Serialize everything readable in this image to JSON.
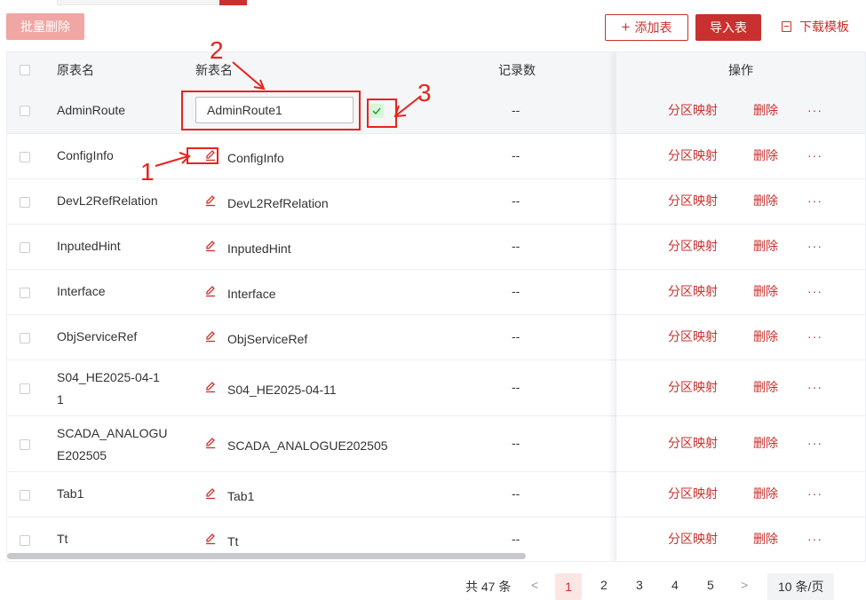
{
  "toolbar": {
    "batch_delete": "批量删除",
    "add_table": "添加表",
    "import_table": "导入表",
    "download_template": "下载模板"
  },
  "table": {
    "headers": {
      "original_name": "原表名",
      "new_name": "新表名",
      "record_count": "记录数",
      "actions": "操作"
    },
    "editing": {
      "original_name": "AdminRoute",
      "input_value": "AdminRoute1"
    },
    "rows": [
      {
        "original_name": "ConfigInfo",
        "new_name": "ConfigInfo",
        "count": "--"
      },
      {
        "original_name": "DevL2RefRelation",
        "new_name": "DevL2RefRelation",
        "count": "--"
      },
      {
        "original_name": "InputedHint",
        "new_name": "InputedHint",
        "count": "--"
      },
      {
        "original_name": "Interface",
        "new_name": "Interface",
        "count": "--"
      },
      {
        "original_name": "ObjServiceRef",
        "new_name": "ObjServiceRef",
        "count": "--"
      },
      {
        "original_name": "S04_HE2025-04-11",
        "original_name_line1": "S04_HE2025-04-1",
        "original_name_line2": "1",
        "new_name": "S04_HE2025-04-11",
        "count": "--"
      },
      {
        "original_name": "SCADA_ANALOGUE202505",
        "original_name_line1": "SCADA_ANALOGU",
        "original_name_line2": "E202505",
        "new_name": "SCADA_ANALOGUE202505",
        "count": "--"
      },
      {
        "original_name": "Tab1",
        "new_name": "Tab1",
        "count": "--"
      },
      {
        "original_name": "Tt",
        "new_name": "Tt",
        "count": "--"
      }
    ],
    "editing_count": "--",
    "action_map": "分区映射",
    "action_delete": "删除",
    "action_more": "···"
  },
  "annotations": {
    "a1": "1",
    "a2": "2",
    "a3": "3",
    "color": "#e8231e"
  },
  "pagination": {
    "total": "共 47 条",
    "prev": "<",
    "pages": [
      "1",
      "2",
      "3",
      "4",
      "5"
    ],
    "next": ">",
    "page_size": "10 条/页"
  },
  "colors": {
    "primary": "#c8312f",
    "primary_light": "#f0a6a2",
    "header_bg": "#f5f6f8",
    "confirm_bg": "#d9f5dc",
    "confirm_check": "#2aa53a"
  }
}
